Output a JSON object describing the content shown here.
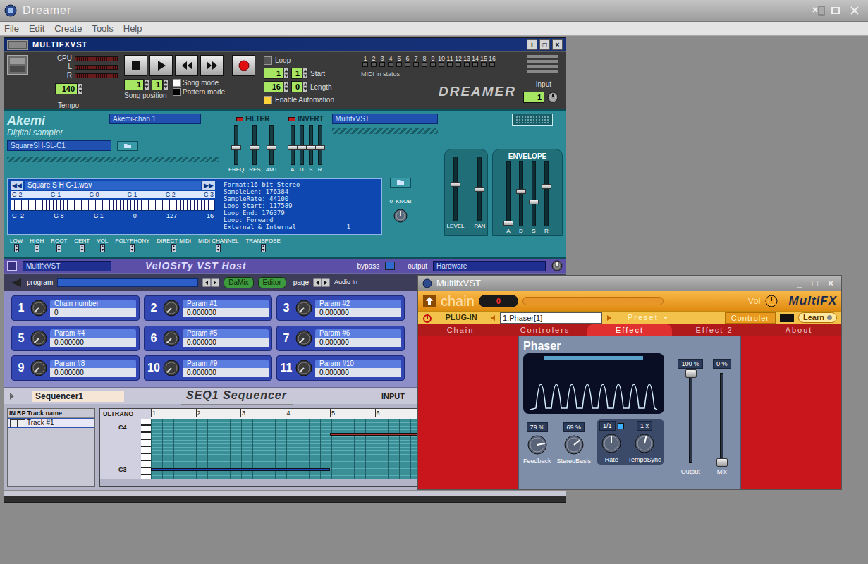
{
  "app": {
    "title": "Dreamer",
    "menu": [
      "File",
      "Edit",
      "Create",
      "Tools",
      "Help"
    ]
  },
  "rack": {
    "title": "MULTIFXVST",
    "buttons": [
      "i",
      "□",
      "×"
    ]
  },
  "transport": {
    "meters": [
      {
        "label": "CPU",
        "level": 0
      },
      {
        "label": "L",
        "level": 0
      },
      {
        "label": "R",
        "level": 0
      }
    ],
    "tempo": {
      "value": "140",
      "label": "Tempo"
    },
    "buttons": [
      {
        "kind": "stop"
      },
      {
        "kind": "play"
      },
      {
        "kind": "rewind"
      },
      {
        "kind": "forward"
      },
      {
        "kind": "record"
      }
    ],
    "song_position": {
      "bar": "1",
      "beat": "1",
      "label": "Song position"
    },
    "modes": [
      {
        "label": "Song mode",
        "selected": false
      },
      {
        "label": "Pattern mode",
        "selected": true
      }
    ],
    "loop": {
      "label": "Loop",
      "checked": false
    },
    "start": {
      "bar": "1",
      "beat": "1",
      "label": "Start"
    },
    "length": {
      "bar": "16",
      "beat": "0",
      "label": "Length"
    },
    "automation": {
      "label": "Enable Automation",
      "checked": true
    },
    "midi": {
      "label": "MIDI in status",
      "channels": [
        {
          "number": "1",
          "on": false
        },
        {
          "number": "2",
          "on": false
        },
        {
          "number": "3",
          "on": false
        },
        {
          "number": "4",
          "on": false
        },
        {
          "number": "5",
          "on": false
        },
        {
          "number": "6",
          "on": false
        },
        {
          "number": "7",
          "on": false
        },
        {
          "number": "8",
          "on": false
        },
        {
          "number": "9",
          "on": false
        },
        {
          "number": "10",
          "on": false
        },
        {
          "number": "11",
          "on": false
        },
        {
          "number": "12",
          "on": false
        },
        {
          "number": "13",
          "on": false
        },
        {
          "number": "14",
          "on": false
        },
        {
          "number": "15",
          "on": false
        },
        {
          "number": "16",
          "on": false
        }
      ]
    },
    "logo": "DREAMER",
    "input": {
      "label": "Input",
      "value": "1"
    }
  },
  "sampler": {
    "logo": "Akemi",
    "subtitle": "Digital sampler",
    "instance": "Akemi-chan 1",
    "route": "MultifxVST",
    "sample": "SquareSH-SL-C1",
    "filter": {
      "label": "FILTER",
      "sliders": [
        {
          "label": "FREQ",
          "level": 0.45
        },
        {
          "label": "RES",
          "level": 0.45
        },
        {
          "label": "AMT",
          "level": 0.45
        }
      ]
    },
    "invert": {
      "label": "INVERT",
      "sliders": [
        {
          "label": "A",
          "level": 0.45
        },
        {
          "label": "D",
          "level": 0.45
        },
        {
          "label": "S",
          "level": 0.45
        },
        {
          "label": "R",
          "level": 0.45
        }
      ]
    },
    "envelope": {
      "label": "ENVELOPE",
      "sliders": [
        {
          "label": "LEVEL",
          "level": 0.58
        },
        {
          "label": "PAN",
          "level": 0.5
        },
        {
          "label": "A",
          "level": 0.05
        },
        {
          "label": "D",
          "level": 0.55
        },
        {
          "label": "S",
          "level": 0.38
        },
        {
          "label": "R",
          "level": 0.62
        }
      ]
    },
    "display": {
      "prev": "◀◀",
      "file": "Square S H C-1.wav",
      "next": "▶▶",
      "octaves": [
        "C-2",
        "C-1",
        "C 0",
        "C 1",
        "C 2",
        "C 3"
      ],
      "zone": [
        "C -2",
        "G 8",
        "C 1",
        "0",
        "127",
        "16"
      ],
      "info": [
        "Format:16-bit Stereo",
        "SampleLen: 176384",
        "SampleRate: 44100",
        "Loop Start: 117589",
        "Loop End: 176379",
        "Loop: Forward",
        "External & Internal"
      ],
      "info_extra": "1",
      "knob_value": "0",
      "knob_label": "KNOB"
    },
    "controls": [
      "LOW",
      "HIGH",
      "ROOT",
      "CENT",
      "VOL",
      "POLYPHONY",
      "DIRECT MIDI",
      "MIDI CHANNEL",
      "TRANSPOSE"
    ]
  },
  "host": {
    "name": "MultifxVST",
    "title": "VelOSiTy VST Host",
    "bypass": {
      "label": "bypass",
      "checked": false
    },
    "output_label": "output",
    "output": "Hardware",
    "program_label": "program",
    "buttons": [
      "DaMix",
      "Editor"
    ],
    "page_label": "page",
    "audio_in": "Audio In"
  },
  "params": [
    {
      "number": "1",
      "label": "Chain number",
      "value": "0",
      "level": 0
    },
    {
      "number": "2",
      "label": "Param #1",
      "value": "0.000000",
      "level": 0
    },
    {
      "number": "3",
      "label": "Param #2",
      "value": "0.000000",
      "level": 0
    },
    {
      "number": "5",
      "label": "Param #4",
      "value": "0.000000",
      "level": 0
    },
    {
      "number": "6",
      "label": "Param #5",
      "value": "0.000000",
      "level": 0
    },
    {
      "number": "7",
      "label": "Param #6",
      "value": "0.000000",
      "level": 0
    },
    {
      "number": "9",
      "label": "Param #8",
      "value": "0.000000",
      "level": 0
    },
    {
      "number": "10",
      "label": "Param #9",
      "value": "0.000000",
      "level": 0
    },
    {
      "number": "11",
      "label": "Param #10",
      "value": "0.000000",
      "level": 0
    }
  ],
  "sequencer": {
    "name": "Sequencer1",
    "title": "SEQ1 Sequencer",
    "input": "INPUT",
    "columns": [
      "IN",
      "RP",
      "Track name"
    ],
    "tracks": [
      {
        "name": "Track #1",
        "selected": true
      }
    ],
    "roll_label": "ULTRANO",
    "bars": [
      "1",
      "2",
      "3",
      "4",
      "5",
      "6"
    ],
    "keys": [
      {
        "label": "C4",
        "row": 2
      },
      {
        "label": "C3",
        "row": 14
      }
    ],
    "notes": [
      {
        "row": 4,
        "start": 5,
        "length": 2,
        "color": "#b03030"
      },
      {
        "row": 14,
        "start": 1,
        "length": 4,
        "color": "#2040c0"
      }
    ]
  },
  "plugin": {
    "title": "MultifxVST",
    "buttons": [
      "_",
      "□",
      "×"
    ],
    "chain_label": "chain",
    "chain_value": "0",
    "vol_label": "Vol",
    "vol_level": 0.5,
    "logo": "MultiFX",
    "plugin_label": "PLUG-IN",
    "plugin_name": "1:Phaser[1]",
    "preset": "Preset",
    "controller": "Controler",
    "learn": "Learn",
    "tabs": [
      {
        "label": "Chain",
        "selected": false
      },
      {
        "label": "Controlers",
        "selected": false
      },
      {
        "label": "Effect",
        "selected": true
      },
      {
        "label": "Effect 2",
        "selected": false
      },
      {
        "label": "About",
        "selected": false
      }
    ],
    "effect": {
      "title": "Phaser",
      "knobs": [
        {
          "label": "Feedback",
          "value": "79 %",
          "level": 0.79
        },
        {
          "label": "StereoBasis",
          "value": "69 %",
          "level": 0.69
        },
        {
          "label": "Rate",
          "value": "1/1",
          "level": 0.5
        },
        {
          "label": "TempoSync",
          "value": "1 x",
          "level": 0.55
        }
      ],
      "sync": {
        "checked": true
      },
      "faders": [
        {
          "label": "Output",
          "value": "100 %",
          "level": 1
        },
        {
          "label": "Mix",
          "value": "0 %",
          "level": 0
        }
      ]
    }
  }
}
